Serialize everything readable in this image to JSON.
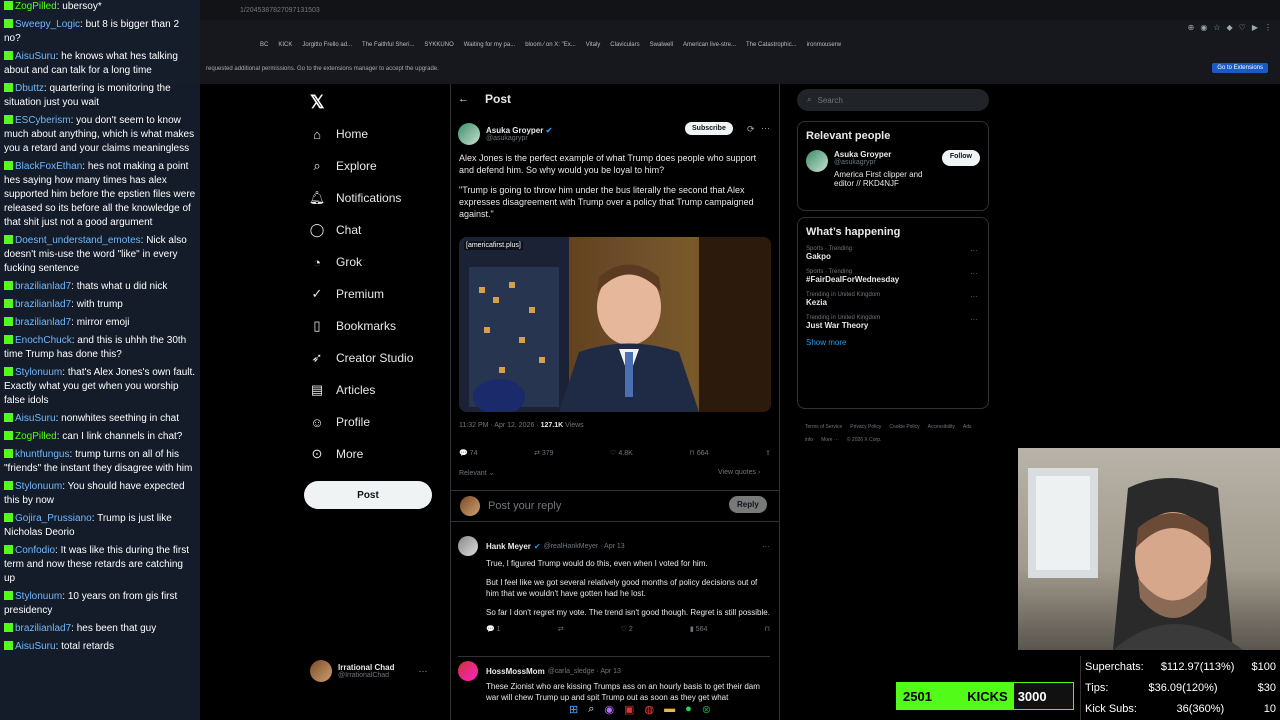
{
  "browser": {
    "tabs": [
      "Go to the extensions manager to accept the upgrade."
    ],
    "url_fragment": "1/2045387827097131503",
    "bookmarks": [
      "BC",
      "KICK",
      "Jorgitto Frello ad...",
      "The Faithful Sheri...",
      "SYKKUNO",
      "Waiting for my pa...",
      "bloom ⁄ on X: \"Ex...",
      "Vitaly",
      "Claviculars",
      "Swalwell",
      "American live-stre...",
      "The Catastrophic...",
      "ironmouserw"
    ],
    "infobar_text": "requested additional permissions. Go to the extensions manager to accept the upgrade.",
    "extensions_button": "Go to Extensions"
  },
  "chat": [
    {
      "user": "ZogPilled",
      "text": "ubersoy*",
      "color": "#53fc18"
    },
    {
      "user": "Sweepy_Logic",
      "text": "but 8 is bigger than 2 no?",
      "color": "#6fb8ff"
    },
    {
      "user": "AisuSuru",
      "text": "he knows what hes talking about and can talk for a long time",
      "color": "#6fb8ff"
    },
    {
      "user": "Dbuttz",
      "text": "quartering is monitoring the situation just you wait",
      "color": "#6fb8ff"
    },
    {
      "user": "ESCyberism",
      "text": "you don't seem to know much about anything, which is what makes you a retard and your claims meaningless",
      "color": "#6fb8ff"
    },
    {
      "user": "BlackFoxEthan",
      "text": "hes not making a point hes saying how many times has alex supported him before the epstien files were released so its before all the knowledge of that shit just not a good argument",
      "color": "#6fb8ff"
    },
    {
      "user": "Doesnt_understand_emotes",
      "text": "Nick also doesn't mis-use the word \"like\" in every fucking sentence",
      "color": "#6fb8ff"
    },
    {
      "user": "brazilianlad7",
      "text": "thats what u did nick",
      "color": "#6fb8ff"
    },
    {
      "user": "brazilianlad7",
      "text": "with trump",
      "color": "#6fb8ff"
    },
    {
      "user": "brazilianlad7",
      "text": "mirror emoji",
      "color": "#6fb8ff"
    },
    {
      "user": "EnochChuck",
      "text": "and this is uhhh the 30th time Trump has done this?",
      "color": "#6fb8ff"
    },
    {
      "user": "Stylonuum",
      "text": "that's Alex Jones's own fault. Exactly what you get when you worship false idols",
      "color": "#6fb8ff"
    },
    {
      "user": "AisuSuru",
      "text": "nonwhites seething in chat",
      "color": "#6fb8ff"
    },
    {
      "user": "ZogPilled",
      "text": "can I link channels in chat?",
      "color": "#53fc18"
    },
    {
      "user": "khuntfungus",
      "text": "trump turns on all of his \"friends\" the instant they disagree with him",
      "color": "#6fb8ff"
    },
    {
      "user": "Stylonuum",
      "text": "You should have expected this by now",
      "color": "#6fb8ff"
    },
    {
      "user": "Gojira_Prussiano",
      "text": "Trump is just like Nicholas Deorio",
      "color": "#6fb8ff"
    },
    {
      "user": "Confodio",
      "text": "It was like this during the first term and now these retards are catching up",
      "color": "#6fb8ff"
    },
    {
      "user": "Stylonuum",
      "text": "10 years on from gis first presidency",
      "color": "#6fb8ff"
    },
    {
      "user": "brazilianlad7",
      "text": "hes been that guy",
      "color": "#6fb8ff"
    },
    {
      "user": "AisuSuru",
      "text": "total retards",
      "color": "#6fb8ff"
    }
  ],
  "nav": {
    "items": [
      "Home",
      "Explore",
      "Notifications",
      "Chat",
      "Grok",
      "Premium",
      "Bookmarks",
      "Creator Studio",
      "Articles",
      "Profile",
      "More"
    ],
    "icons": [
      "home-icon",
      "search-icon",
      "bell-icon",
      "chat-icon",
      "grok-icon",
      "premium-icon",
      "bookmark-icon",
      "rocket-icon",
      "articles-icon",
      "person-icon",
      "more-icon"
    ],
    "post_button": "Post",
    "account_name": "Irrational Chad",
    "account_handle": "@IrrationalChad"
  },
  "post": {
    "header": "Post",
    "author_name": "Asuka Groyper",
    "author_handle": "@asukagrypr",
    "subscribe": "Subscribe",
    "text1": "Alex Jones is the perfect example of what Trump does people who support and defend him. So why would you be loyal to him?",
    "text2": "\"Trump is going to throw him under the bus literally the second that Alex expresses disagreement with Trump over a policy that Trump campaigned against.\"",
    "image_label": "[americafirst.plus]",
    "timestamp": "11:32 PM · Apr 12, 2026 ·",
    "views_count": "127.1K",
    "views_label": "Views",
    "replies": "74",
    "reposts": "379",
    "likes": "4.8K",
    "bookmarks": "664",
    "relevant": "Relevant",
    "view_quotes": "View quotes",
    "reply_placeholder": "Post your reply",
    "reply_button": "Reply"
  },
  "replies": [
    {
      "name": "Hank Meyer",
      "handle": "@realHankMeyer · Apr 13",
      "lines": [
        "True, I figured Trump would do this, even when I voted for him.",
        "But I feel like we got several relatively good months of policy decisions out of him that we wouldn't have gotten had he lost.",
        "So far I don't regret my vote. The trend isn't good though. Regret is still possible."
      ],
      "replies": "1",
      "likes": "2",
      "views": "564"
    },
    {
      "name": "HossMossMom",
      "handle": "@carla_sledge · Apr 13",
      "lines": [
        "These Zionist who are kissing Trumps ass on an hourly basis to get their dam war will chew Trump up and spit Trump out as soon as they get what"
      ]
    }
  ],
  "sidebar": {
    "search_placeholder": "Search",
    "relevant_title": "Relevant people",
    "person_name": "Asuka Groyper",
    "person_handle": "@asukagrypr",
    "person_bio": "America First clipper and editor // RKD4NJF",
    "follow": "Follow",
    "happening_title": "What’s happening",
    "trends": [
      {
        "cat": "Sports · Trending",
        "name": "Gakpo"
      },
      {
        "cat": "Sports · Trending",
        "name": "#FairDealForWednesday"
      },
      {
        "cat": "Trending in United Kingdom",
        "name": "Kezia"
      },
      {
        "cat": "Trending in United Kingdom",
        "name": "Just War Theory"
      }
    ],
    "show_more": "Show more",
    "footer": [
      "Terms of Service",
      "Privacy Policy",
      "Cookie Policy",
      "Accessibility",
      "Ads info",
      "More ···",
      "© 2026 X Corp."
    ]
  },
  "overlay": {
    "superchats_label": "Superchats:",
    "superchats_value": "$112.97(113%)",
    "superchats_goal": "$100",
    "tips_label": "Tips:",
    "tips_value": "$36.09(120%)",
    "tips_goal": "$30",
    "subs_label": "Kick Subs:",
    "subs_value": "36(360%)",
    "subs_goal": "10",
    "kick_current": "2501",
    "kick_label": "KICKS",
    "kick_goal": "3000",
    "kick_progress": 0.8337
  }
}
